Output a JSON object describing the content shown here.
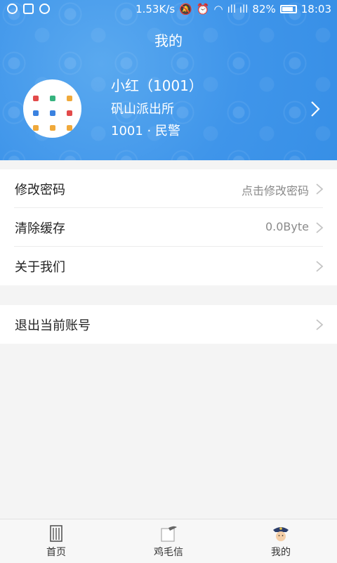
{
  "status_bar": {
    "speed": "1.53K/s",
    "signal": "ıll ıll",
    "battery": "82%",
    "time": "18:03"
  },
  "header": {
    "title": "我的"
  },
  "profile": {
    "name": "小红（1001）",
    "station": "矾山派出所",
    "role": "1001 · 民警"
  },
  "settings": [
    {
      "label": "修改密码",
      "value": "点击修改密码"
    },
    {
      "label": "清除缓存",
      "value": "0.0Byte"
    },
    {
      "label": "关于我们",
      "value": ""
    }
  ],
  "account": {
    "label": "退出当前账号"
  },
  "tabs": [
    {
      "label": "首页",
      "icon": "building-icon"
    },
    {
      "label": "鸡毛信",
      "icon": "letter-icon"
    },
    {
      "label": "我的",
      "icon": "police-icon",
      "active": true
    }
  ],
  "colors": {
    "header_blue": "#3f95ea",
    "background": "#f4f4f4"
  }
}
